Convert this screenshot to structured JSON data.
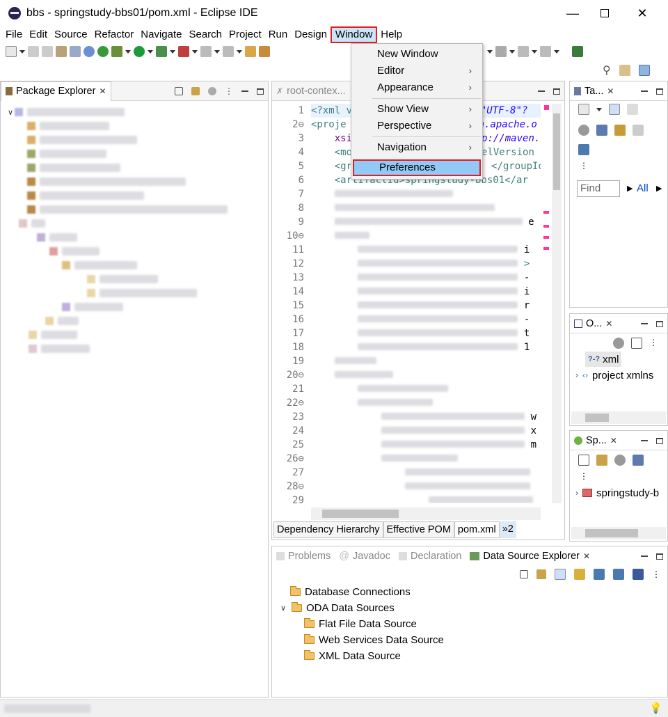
{
  "window": {
    "title": "bbs - springstudy-bbs01/pom.xml - Eclipse IDE",
    "minimize": "—",
    "close": "✕"
  },
  "menubar": [
    "File",
    "Edit",
    "Source",
    "Refactor",
    "Navigate",
    "Search",
    "Project",
    "Run",
    "Design",
    "Window",
    "Help"
  ],
  "window_menu": {
    "items": [
      {
        "label": "New Window",
        "submenu": false
      },
      {
        "label": "Editor",
        "submenu": true
      },
      {
        "label": "Appearance",
        "submenu": true
      },
      {
        "label": "Show View",
        "submenu": true
      },
      {
        "label": "Perspective",
        "submenu": true
      },
      {
        "label": "Navigation",
        "submenu": true
      },
      {
        "label": "Preferences",
        "submenu": false
      }
    ],
    "highlighted": "Preferences"
  },
  "package_explorer": {
    "tab_label": "Package Explorer",
    "close": "✕"
  },
  "editor": {
    "tab_label": "root-contex...",
    "line_numbers": [
      "1",
      "2⊖",
      "3",
      "4",
      "5",
      "6",
      "7",
      "8",
      "9",
      "10⊖",
      "11",
      "12",
      "13",
      "14",
      "15",
      "16",
      "17",
      "18",
      "19",
      "20⊖",
      "21",
      "22⊖",
      "23",
      "24",
      "25",
      "26⊖",
      "27",
      "28⊖",
      "29"
    ],
    "visible_code": {
      "l1a": "<?xml v",
      "l1b": "g=\"UTF-8\"?",
      "l2a": "<proje",
      "l2b": "n.apache.o",
      "l3a": "xsi",
      "l3b": "p://maven.",
      "l4a": "<mo",
      "l4b": "elVersion",
      "l5a": "<gr",
      "l5b": "</groupId",
      "l6a": "<artifactId>springstudy-bbs01</ar",
      "l9e": "e",
      "l11": "i",
      "l12": ">",
      "l13": "-",
      "l14": "i",
      "l15": "r",
      "l16": "-",
      "l17": "t",
      "l18": "1",
      "l23": "w",
      "l24": "x",
      "l25": "m"
    },
    "bottom_tabs": [
      "Dependency Hierarchy",
      "Effective POM",
      "pom.xml",
      "»2"
    ]
  },
  "right_top": {
    "tab_label": "Ta...",
    "find_placeholder": "Find",
    "all_label": "All"
  },
  "outline": {
    "tab_label": "O...",
    "items": [
      "xml",
      "project xmlns"
    ],
    "xml_badge": "?-?"
  },
  "spring": {
    "tab_label": "Sp...",
    "items": [
      "springstudy-b"
    ]
  },
  "bottom": {
    "tabs": [
      {
        "label": "Problems",
        "active": false
      },
      {
        "label": "Javadoc",
        "active": false
      },
      {
        "label": "Declaration",
        "active": false
      },
      {
        "label": "Data Source Explorer",
        "active": true
      }
    ],
    "tree": [
      {
        "label": "Database Connections",
        "level": 0,
        "twisty": ""
      },
      {
        "label": "ODA Data Sources",
        "level": 0,
        "twisty": "∨"
      },
      {
        "label": "Flat File Data Source",
        "level": 1,
        "twisty": ""
      },
      {
        "label": "Web Services Data Source",
        "level": 1,
        "twisty": ""
      },
      {
        "label": "XML Data Source",
        "level": 1,
        "twisty": ""
      }
    ]
  },
  "colors": {
    "highlight_border": "#e02020",
    "menu_hover": "#91c9f7",
    "xml_tag": "#3f7f7f",
    "xml_string": "#2a00ff"
  }
}
